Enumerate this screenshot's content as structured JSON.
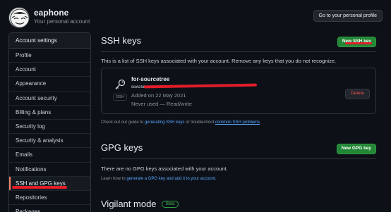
{
  "header": {
    "username": "eaphone",
    "subtitle": "Your personal account",
    "profile_button": "Go to your personal profile"
  },
  "sidebar": {
    "heading": "Account settings",
    "items": [
      {
        "label": "Profile"
      },
      {
        "label": "Account"
      },
      {
        "label": "Appearance"
      },
      {
        "label": "Account security"
      },
      {
        "label": "Billing & plans"
      },
      {
        "label": "Security log"
      },
      {
        "label": "Security & analysis"
      },
      {
        "label": "Emails"
      },
      {
        "label": "Notifications"
      },
      {
        "label": "SSH and GPG keys",
        "selected": true
      },
      {
        "label": "Repositories"
      },
      {
        "label": "Packages"
      }
    ]
  },
  "ssh": {
    "title": "SSH keys",
    "new_button": "New SSH key",
    "description": "This is a list of SSH keys associated with your account. Remove any keys that you do not recognize.",
    "key": {
      "title": "for-sourcetree",
      "fingerprint_prefix": "SHA256:",
      "badge": "SSH",
      "added": "Added on 22 May 2021",
      "usage": "Never used — Read/write",
      "delete_button": "Delete"
    },
    "guide_prefix": "Check out our guide to ",
    "guide_link1": "generating SSH keys",
    "guide_middle": " or troubleshoot ",
    "guide_link2": "common SSH problems",
    "guide_suffix": "."
  },
  "gpg": {
    "title": "GPG keys",
    "new_button": "New GPG key",
    "empty_text": "There are no GPG keys associated with your account.",
    "learn_prefix": "Learn how to ",
    "learn_link": "generate a GPG key and add it to your account",
    "learn_suffix": "."
  },
  "vigilant": {
    "title": "Vigilant mode",
    "badge": "Beta"
  },
  "colors": {
    "background": "#0d1117",
    "green_button": "#238636",
    "link": "#58a6ff",
    "danger": "#f85149",
    "annotation_red": "#e11d2a"
  }
}
